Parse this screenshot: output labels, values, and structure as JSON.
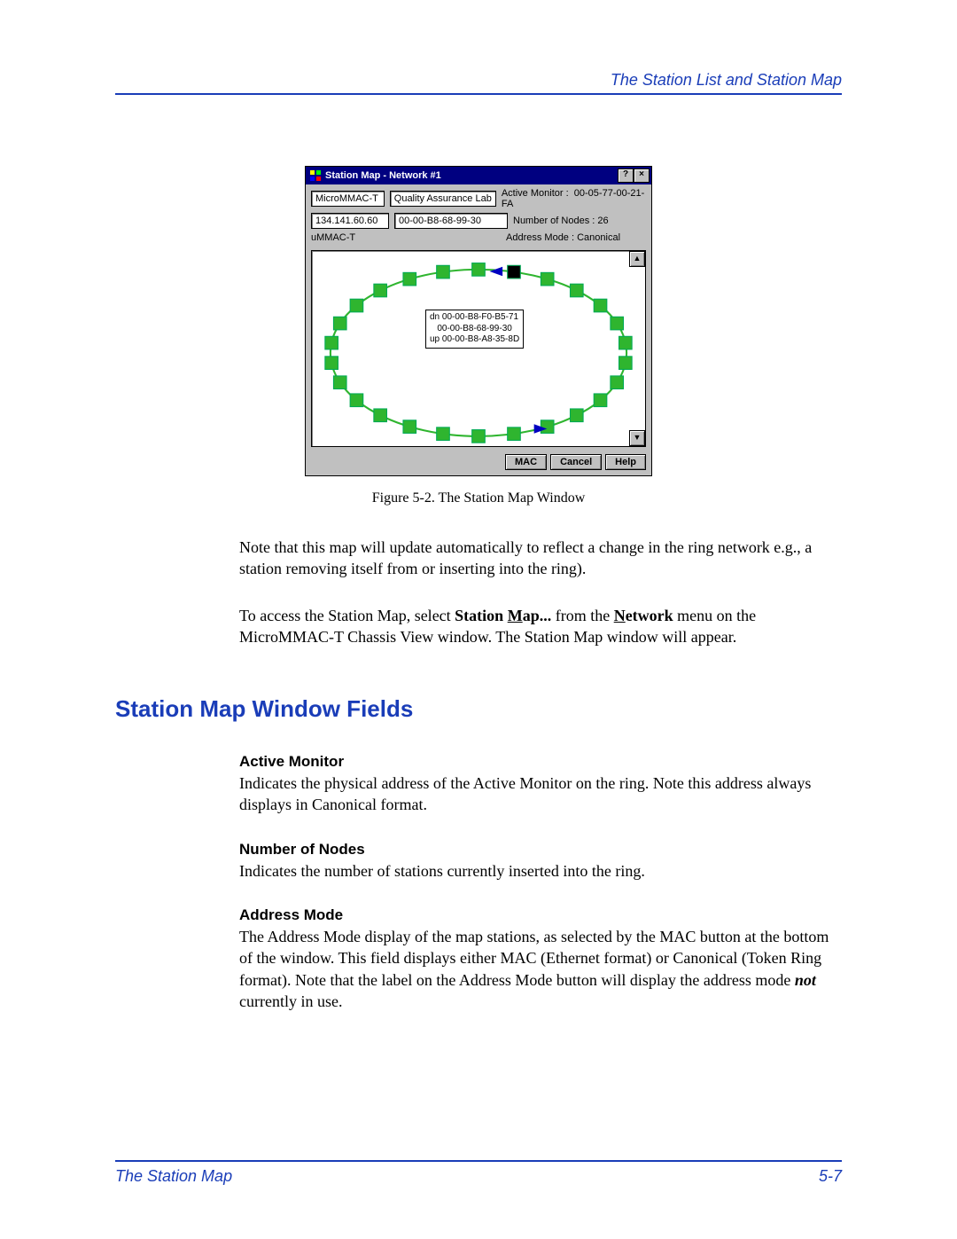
{
  "header": {
    "right": "The Station List and Station Map"
  },
  "footer": {
    "left": "The Station Map",
    "right": "5-7"
  },
  "figure": {
    "caption": "Figure 5-2. The Station Map Window",
    "window": {
      "title": "Station Map - Network #1",
      "help_glyph": "?",
      "close_glyph": "×",
      "row1": {
        "name": "MicroMMAC-T",
        "desc": "Quality Assurance Lab",
        "label": "Active Monitor :",
        "value": "00-05-77-00-21-FA"
      },
      "row2": {
        "name": "134.141.60.60",
        "desc": "00-00-B8-68-99-30",
        "label": "Number of Nodes : 26"
      },
      "row3": {
        "name": "uMMAC-T",
        "label": "Address Mode    :  Canonical"
      },
      "tooltip": {
        "dn": "dn 00-00-B8-F0-B5-71",
        "mid": "00-00-B8-68-99-30",
        "up": "up 00-00-B8-A8-35-8D"
      },
      "scroll_up": "▲",
      "scroll_dn": "▼",
      "buttons": {
        "mac": "MAC",
        "cancel": "Cancel",
        "help": "Help"
      },
      "ring": {
        "node_count": 26,
        "node_color": "#2fb52f",
        "special_node_color": "#000000"
      }
    }
  },
  "paragraphs": {
    "p1": "Note that this map will update automatically to reflect a change in the ring network e.g., a station removing itself from or inserting into the ring).",
    "p2_pre": "To access the Station Map, select ",
    "p2_b1a": "Station ",
    "p2_b1u": "M",
    "p2_b1b": "ap...",
    "p2_mid": " from the ",
    "p2_b2u": "N",
    "p2_b2b": "etwork",
    "p2_post": " menu on the MicroMMAC-T Chassis View window. The Station Map window will appear."
  },
  "section": {
    "heading": "Station Map Window Fields"
  },
  "fields": {
    "active_monitor": {
      "h": "Active Monitor",
      "p": "Indicates the physical address of the Active Monitor on the ring. Note this address always displays in Canonical format."
    },
    "num_nodes": {
      "h": "Number of Nodes",
      "p": "Indicates the number of stations currently inserted into the ring."
    },
    "addr_mode": {
      "h": "Address Mode",
      "p_pre": "The Address Mode display of the map stations, as selected by the MAC button at the bottom of the window. This field displays either MAC (Ethernet format) or Canonical (Token Ring format). Note that the label on the Address Mode button will display the address mode ",
      "p_em": "not",
      "p_post": " currently in use."
    }
  }
}
